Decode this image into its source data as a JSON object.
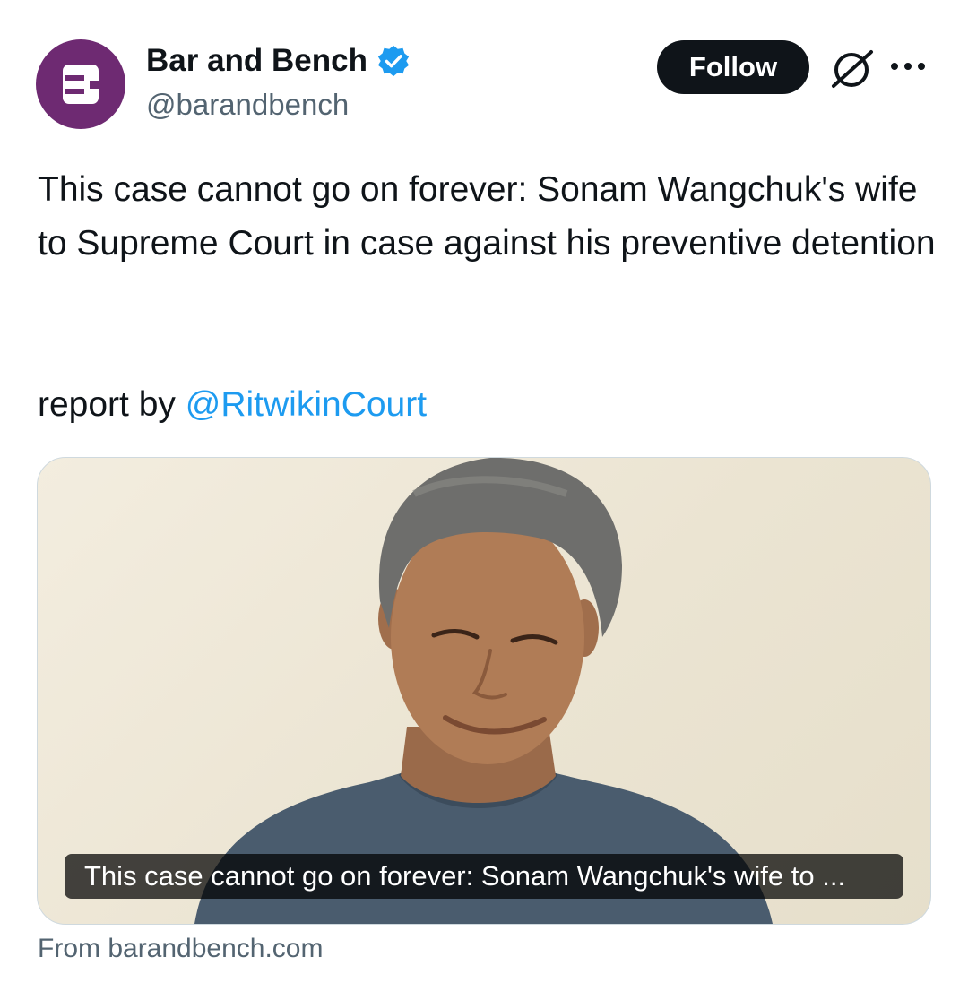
{
  "account": {
    "display_name": "Bar and Bench",
    "handle": "@barandbench",
    "verified": true,
    "avatar_color": "#6e2a72"
  },
  "actions": {
    "follow_label": "Follow",
    "grok_icon": "grok-icon",
    "more_icon": "more-icon"
  },
  "tweet": {
    "text": "This case cannot go on forever: Sonam Wangchuk's wife to Supreme Court in case against his preventive detention",
    "report_prefix": "report by ",
    "mention": "@RitwikinCourt"
  },
  "link_card": {
    "caption": "This case cannot go on forever: Sonam Wangchuk's wife to ...",
    "source": "From barandbench.com"
  },
  "colors": {
    "text": "#0f1419",
    "secondary": "#536471",
    "link": "#1d9bf0",
    "button_bg": "#0f1419"
  }
}
